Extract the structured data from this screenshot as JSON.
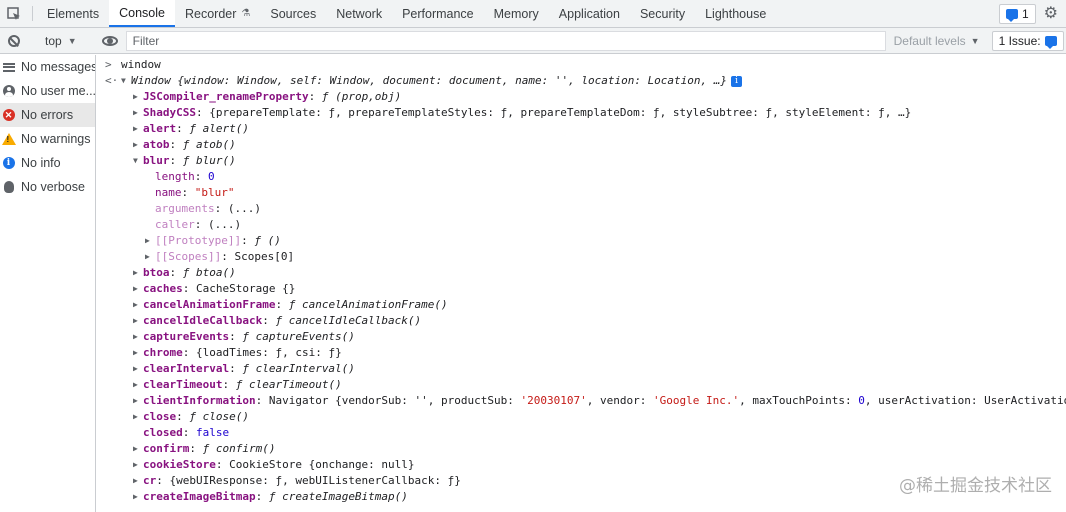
{
  "tabs": {
    "items": [
      "Elements",
      "Console",
      "Recorder",
      "Sources",
      "Network",
      "Performance",
      "Memory",
      "Application",
      "Security",
      "Lighthouse"
    ],
    "active": "Console",
    "issues_count": "1"
  },
  "toolbar": {
    "context": "top",
    "filter_placeholder": "Filter",
    "default_levels": "Default levels",
    "issues_label": "1 Issue:"
  },
  "sidebar": {
    "items": [
      {
        "label": "No messages",
        "icon": "list-icon"
      },
      {
        "label": "No user me...",
        "icon": "user-icon"
      },
      {
        "label": "No errors",
        "icon": "error-icon"
      },
      {
        "label": "No warnings",
        "icon": "warning-icon"
      },
      {
        "label": "No info",
        "icon": "info-icon"
      },
      {
        "label": "No verbose",
        "icon": "bug-icon"
      }
    ],
    "selected_index": 2
  },
  "console": {
    "input": "window",
    "summary": {
      "prefix": "Window {",
      "text": "window: Window, self: Window, document: document, name: '', location: Location, …}"
    },
    "props": {
      "jsc_name": "JSCompiler_renameProperty",
      "jsc_val": "ƒ (prop,obj)",
      "shady_name": "ShadyCSS",
      "shady_val": "{prepareTemplate: ƒ, prepareTemplateStyles: ƒ, prepareTemplateDom: ƒ, styleSubtree: ƒ, styleElement: ƒ, …}",
      "alert_name": "alert",
      "alert_val": "ƒ alert()",
      "atob_name": "atob",
      "atob_val": "ƒ atob()",
      "blur_name": "blur",
      "blur_val": "ƒ blur()",
      "length_name": "length",
      "length_val": "0",
      "bname_name": "name",
      "bname_val": "\"blur\"",
      "arguments_name": "arguments",
      "arguments_val": "(...)",
      "caller_name": "caller",
      "caller_val": "(...)",
      "proto_name": "[[Prototype]]",
      "proto_val": "ƒ ()",
      "scopes_name": "[[Scopes]]",
      "scopes_val": "Scopes[0]",
      "btoa_name": "btoa",
      "btoa_val": "ƒ btoa()",
      "caches_name": "caches",
      "caches_val": "CacheStorage {}",
      "caf_name": "cancelAnimationFrame",
      "caf_val": "ƒ cancelAnimationFrame()",
      "cic_name": "cancelIdleCallback",
      "cic_val": "ƒ cancelIdleCallback()",
      "ce_name": "captureEvents",
      "ce_val": "ƒ captureEvents()",
      "chrome_name": "chrome",
      "chrome_val": "{loadTimes: ƒ, csi: ƒ}",
      "ci_name": "clearInterval",
      "ci_val": "ƒ clearInterval()",
      "ct_name": "clearTimeout",
      "ct_val": "ƒ clearTimeout()",
      "cinfo_name": "clientInformation",
      "cinfo_val_a": "Navigator {vendorSub: '', productSub: ",
      "cinfo_val_b": "'20030107'",
      "cinfo_val_c": ", vendor: ",
      "cinfo_val_d": "'Google Inc.'",
      "cinfo_val_e": ", maxTouchPoints: ",
      "cinfo_val_f": "0",
      "cinfo_val_g": ", userActivation: UserActivatio",
      "close_name": "close",
      "close_val": "ƒ close()",
      "closed_name": "closed",
      "closed_val": "false",
      "confirm_name": "confirm",
      "confirm_val": "ƒ confirm()",
      "cookie_name": "cookieStore",
      "cookie_val": "CookieStore {onchange: null}",
      "cr_name": "cr",
      "cr_val": "{webUIResponse: ƒ, webUIListenerCallback: ƒ}",
      "cib_name": "createImageBitmap",
      "cib_val": "ƒ createImageBitmap()"
    }
  },
  "watermark": "@稀土掘金技术社区"
}
